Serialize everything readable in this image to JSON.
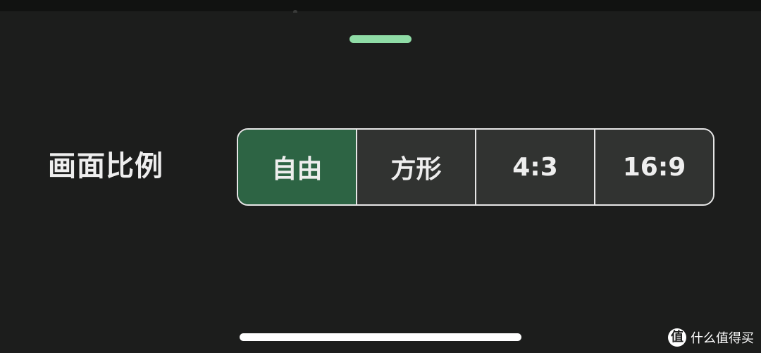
{
  "setting": {
    "label": "画面比例"
  },
  "aspect_ratio": {
    "options": [
      {
        "label": "自由",
        "selected": true
      },
      {
        "label": "方形",
        "selected": false
      },
      {
        "label": "4:3",
        "selected": false
      },
      {
        "label": "16:9",
        "selected": false
      }
    ]
  },
  "watermark": {
    "logo_glyph": "值",
    "text": "什么值得买"
  },
  "colors": {
    "background": "#1c1d1c",
    "selected_segment": "#2d6444",
    "segment": "#313331",
    "handle_accent": "#8fdca6"
  }
}
